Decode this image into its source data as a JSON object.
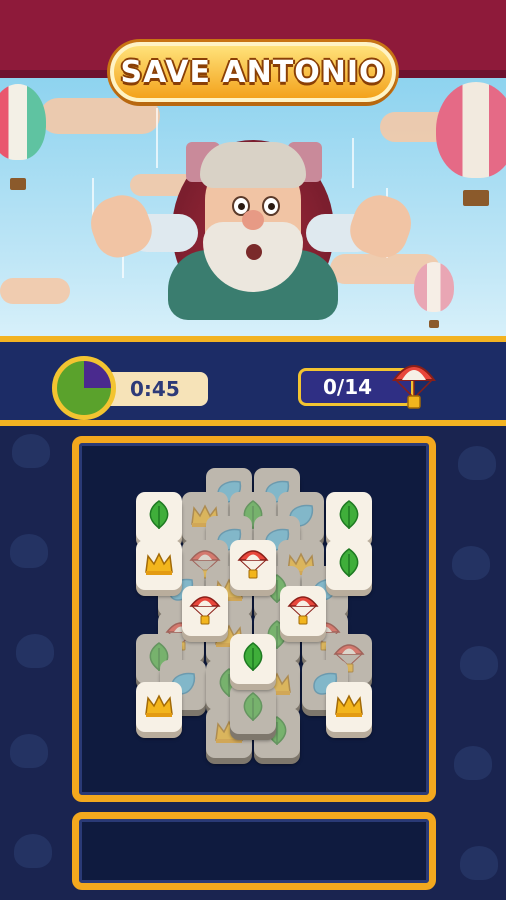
{
  "header": {
    "title": "SAVE ANTONIO"
  },
  "hud": {
    "timer_text": "0:45",
    "timer_remaining_fraction": 0.75,
    "progress_text": "0/14",
    "rescued": 0,
    "goal": 14
  },
  "colors": {
    "top_band": "#8e1a3a",
    "hud_bg": "#1c2c66",
    "accent_gold": "#f3b322",
    "board_bg": "#0f1b3f",
    "tile_face": "#f7f1e6",
    "leaf_green": "#3fae3a",
    "water_blue": "#52b8e0",
    "crown_gold": "#f2b51d"
  },
  "tile_types": [
    "leaf-icon",
    "crown-icon",
    "water-drop-icon",
    "parachute-icon"
  ]
}
